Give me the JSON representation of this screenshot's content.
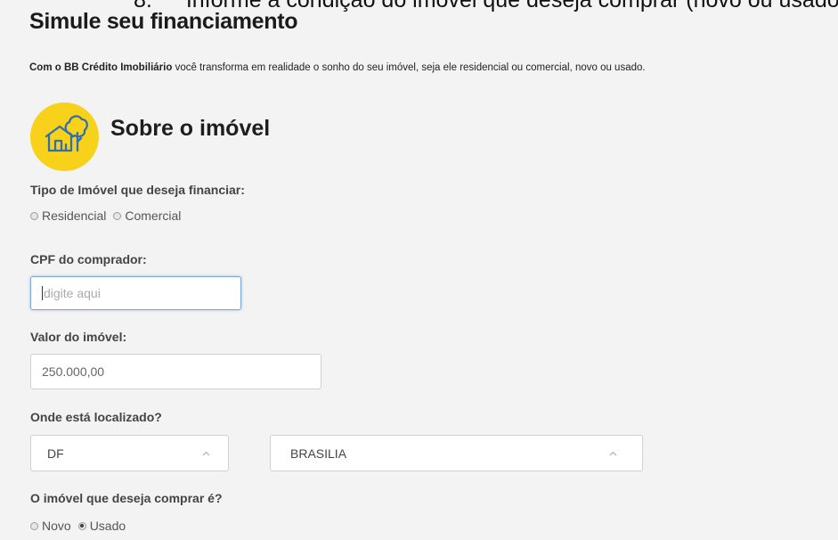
{
  "cut_heading": "Informe a condição do imóvel que deseja comprar (novo ou usado",
  "page_title": "Simule seu financiamento",
  "intro": {
    "brand": "Com o BB Crédito Imobiliário",
    "text": " você transforma em realidade o sonho do seu imóvel, seja ele residencial ou comercial, novo ou usado."
  },
  "section": {
    "icon": "house-tree-icon",
    "title": "Sobre o imóvel"
  },
  "property_type": {
    "label": "Tipo de Imóvel que deseja financiar:",
    "options": [
      {
        "label": "Residencial",
        "checked": false
      },
      {
        "label": "Comercial",
        "checked": false
      }
    ]
  },
  "cpf": {
    "label": "CPF do comprador:",
    "placeholder": "digite aqui"
  },
  "value": {
    "label": "Valor do imóvel:",
    "value": "250.000,00"
  },
  "location": {
    "label": "Onde está localizado?",
    "state": "DF",
    "city": "BRASILIA"
  },
  "condition": {
    "label": "O imóvel que deseja comprar é?",
    "options": [
      {
        "label": "Novo",
        "checked": false
      },
      {
        "label": "Usado",
        "checked": true
      }
    ]
  },
  "colors": {
    "accent": "#f8d21a",
    "icon_stroke": "#2f6fb5",
    "focus": "#79a7d6"
  }
}
